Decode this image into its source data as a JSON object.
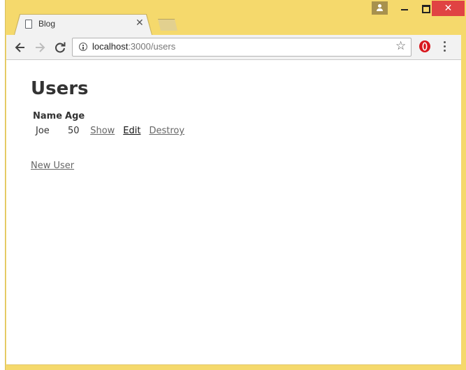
{
  "browser": {
    "tab_title": "Blog",
    "url_host": "localhost",
    "url_path": ":3000/users"
  },
  "page": {
    "title": "Users",
    "table": {
      "headers": [
        "Name",
        "Age"
      ],
      "rows": [
        {
          "name": "Joe",
          "age": "50",
          "actions": [
            "Show",
            "Edit",
            "Destroy"
          ]
        }
      ]
    },
    "new_user_link": "New User"
  },
  "icons": {
    "back": "back-arrow-icon",
    "forward": "forward-arrow-icon",
    "reload": "reload-icon",
    "info": "info-icon",
    "bookmark": "star-icon",
    "extension": "opera-extension-icon",
    "menu": "kebab-menu-icon"
  },
  "colors": {
    "frame": "#f5d96c",
    "close_button": "#e04343",
    "link": "#666666"
  }
}
